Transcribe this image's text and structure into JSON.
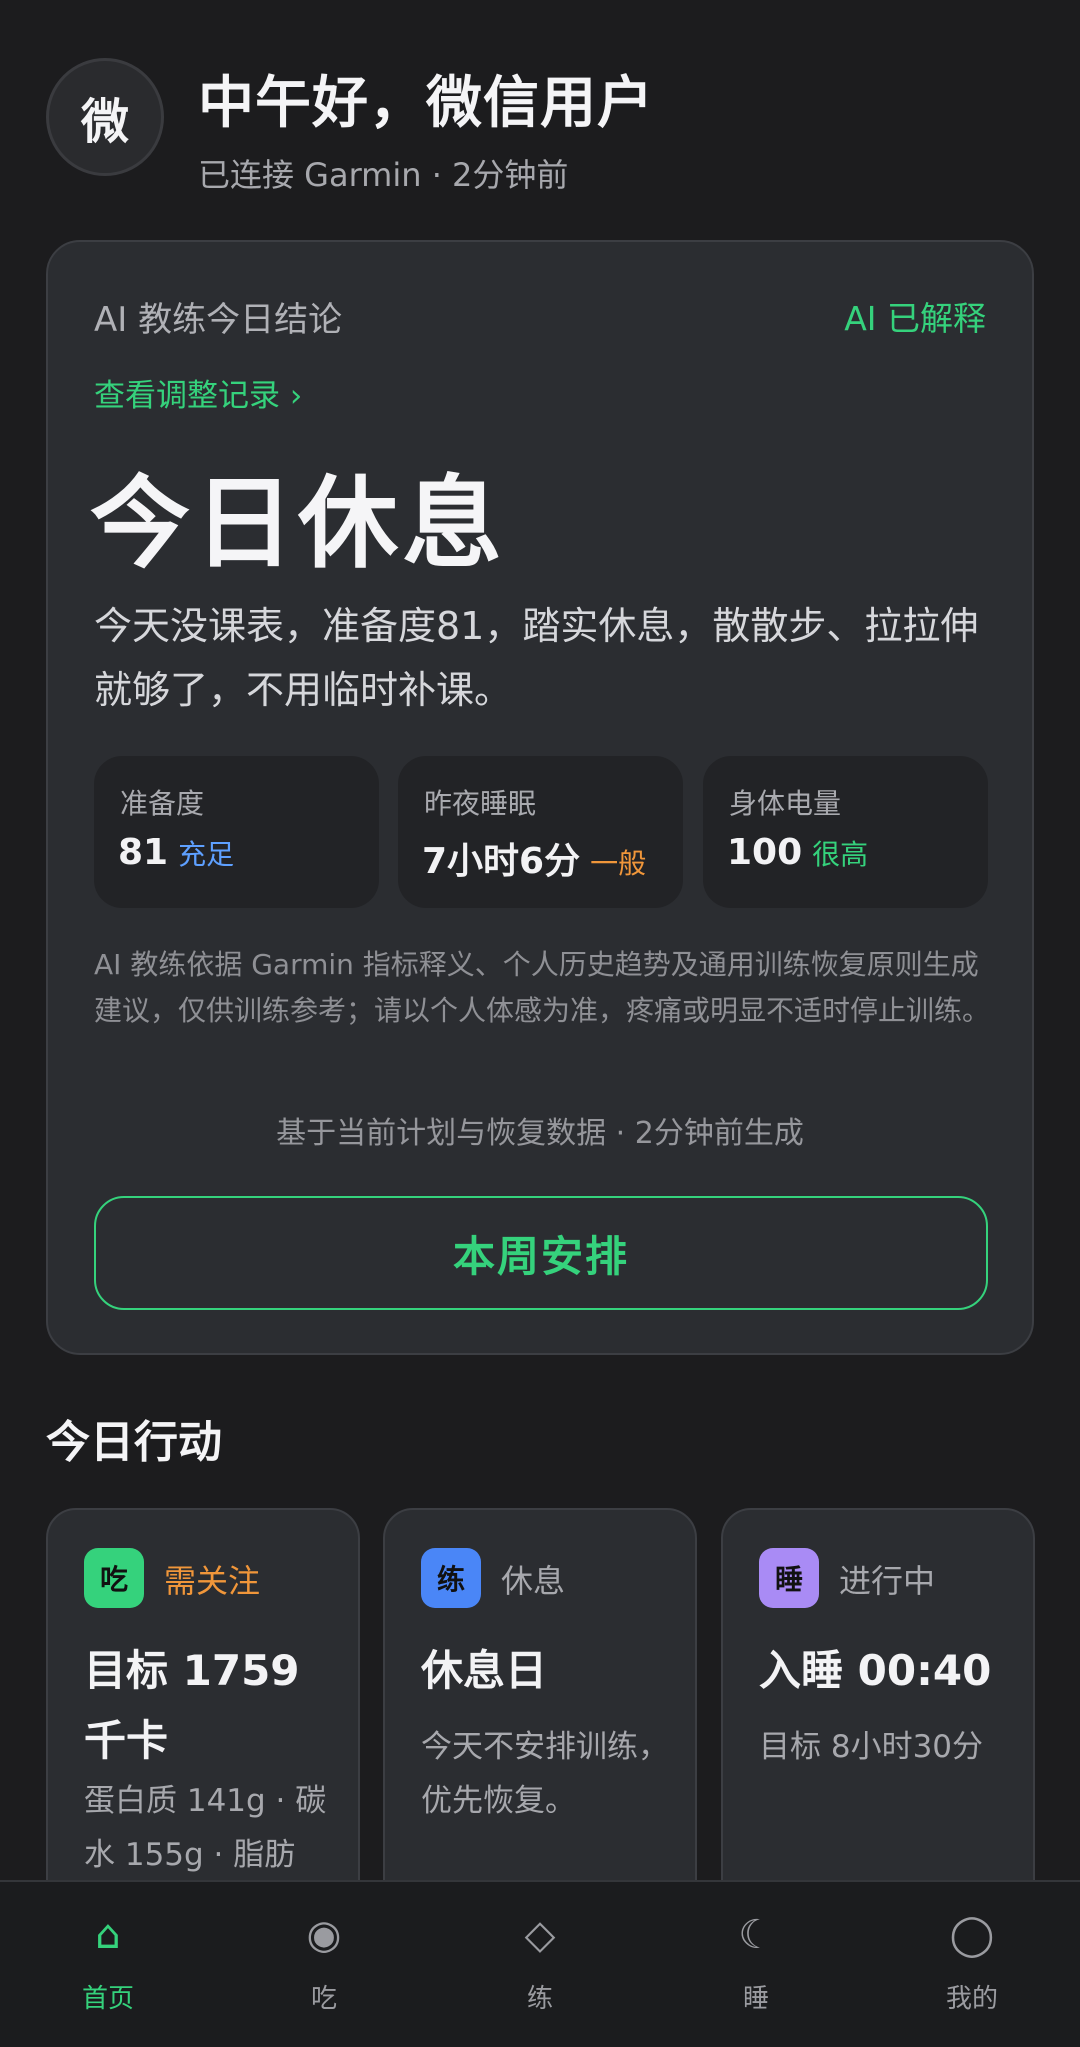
{
  "header": {
    "avatar_text": "微",
    "greeting": "中午好，微信用户",
    "connection": "已连接 Garmin · 2分钟前"
  },
  "ai_card": {
    "title": "AI 教练今日结论",
    "explained_label": "AI 已解释",
    "record_link": "查看调整记录 ›",
    "verdict": "今日休息",
    "summary": "今天没课表，准备度81，踏实休息，散散步、拉拉伸就够了，不用临时补课。",
    "metrics": [
      {
        "label": "准备度",
        "value": "81",
        "tag": "充足",
        "tag_color": "#5ea0ff"
      },
      {
        "label": "昨夜睡眠",
        "value": "7小时6分",
        "tag": "一般",
        "tag_color": "#f0963a"
      },
      {
        "label": "身体电量",
        "value": "100",
        "tag": "很高",
        "tag_color": "#35d27c"
      }
    ],
    "disclaimer": "AI 教练依据 Garmin 指标释义、个人历史趋势及通用训练恢复原则生成建议，仅供训练参考；请以个人体感为准，疼痛或明显不适时停止训练。",
    "generated_note": "基于当前计划与恢复数据 · 2分钟前生成",
    "week_button": "本周安排"
  },
  "today": {
    "section_title": "今日行动",
    "cards": [
      {
        "icon_text": "吃",
        "icon_color": "#35d27c",
        "status": "需关注",
        "status_color": "#f0963a",
        "title": "目标 1759 千卡",
        "desc": "蛋白质 141g · 碳水 155g · 脂肪"
      },
      {
        "icon_text": "练",
        "icon_color": "#4a86f7",
        "status": "休息",
        "status_color": "#a7a8ad",
        "title": "休息日",
        "desc": "今天不安排训练，优先恢复。"
      },
      {
        "icon_text": "睡",
        "icon_color": "#a98bf5",
        "status": "进行中",
        "status_color": "#a7a8ad",
        "title": "入睡 00:40",
        "desc": "目标 8小时30分"
      }
    ]
  },
  "nav": {
    "items": [
      {
        "label": "首页",
        "icon": "⌂",
        "icon_name": "home-icon",
        "active": true
      },
      {
        "label": "吃",
        "icon": "◉",
        "icon_name": "eat-icon",
        "active": false
      },
      {
        "label": "练",
        "icon": "◇",
        "icon_name": "train-icon",
        "active": false
      },
      {
        "label": "睡",
        "icon": "☾",
        "icon_name": "moon-icon",
        "active": false
      },
      {
        "label": "我的",
        "icon": "◯",
        "icon_name": "profile-icon",
        "active": false
      }
    ]
  }
}
